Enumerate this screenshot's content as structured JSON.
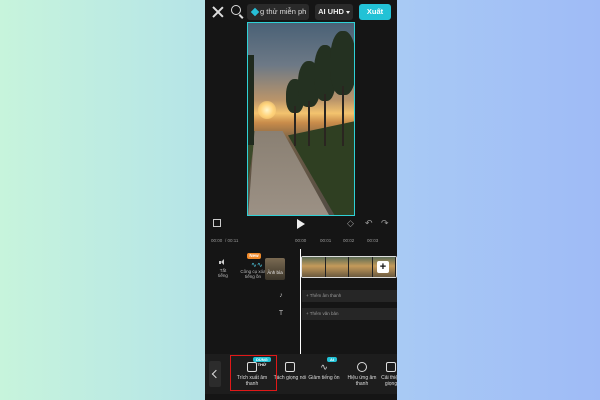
{
  "topbar": {
    "trial_label": "g thử miễn ph",
    "quality_label": "AI UHD",
    "export_label": "Xuất"
  },
  "timeline": {
    "current_time": "00:00",
    "total_time": "/ 00:11",
    "ticks": [
      "00:00",
      "00:01",
      "00:02",
      "00:03"
    ]
  },
  "side_tools": {
    "mute_label": "Tắt tiếng",
    "new_badge": "New",
    "voice_label": "Công cụ xóa tiếng ồn",
    "cover_label": "Ảnh bìa"
  },
  "tracks": {
    "add_audio": "+ Thêm âm thanh",
    "add_text": "+ Thêm văn bản"
  },
  "toolbar": {
    "items": [
      {
        "label": "Trích xuất âm thanh",
        "badge": "DÙNG THỬ"
      },
      {
        "label": "Tách giọng nói",
        "badge": ""
      },
      {
        "label": "Giảm tiếng ồn",
        "badge": "AI"
      },
      {
        "label": "Hiệu ứng âm thanh",
        "badge": ""
      },
      {
        "label": "Cải thiện giọng",
        "badge": ""
      }
    ]
  },
  "colors": {
    "accent": "#22c2d6",
    "highlight": "#e01818",
    "new_badge": "#f08a2a"
  }
}
